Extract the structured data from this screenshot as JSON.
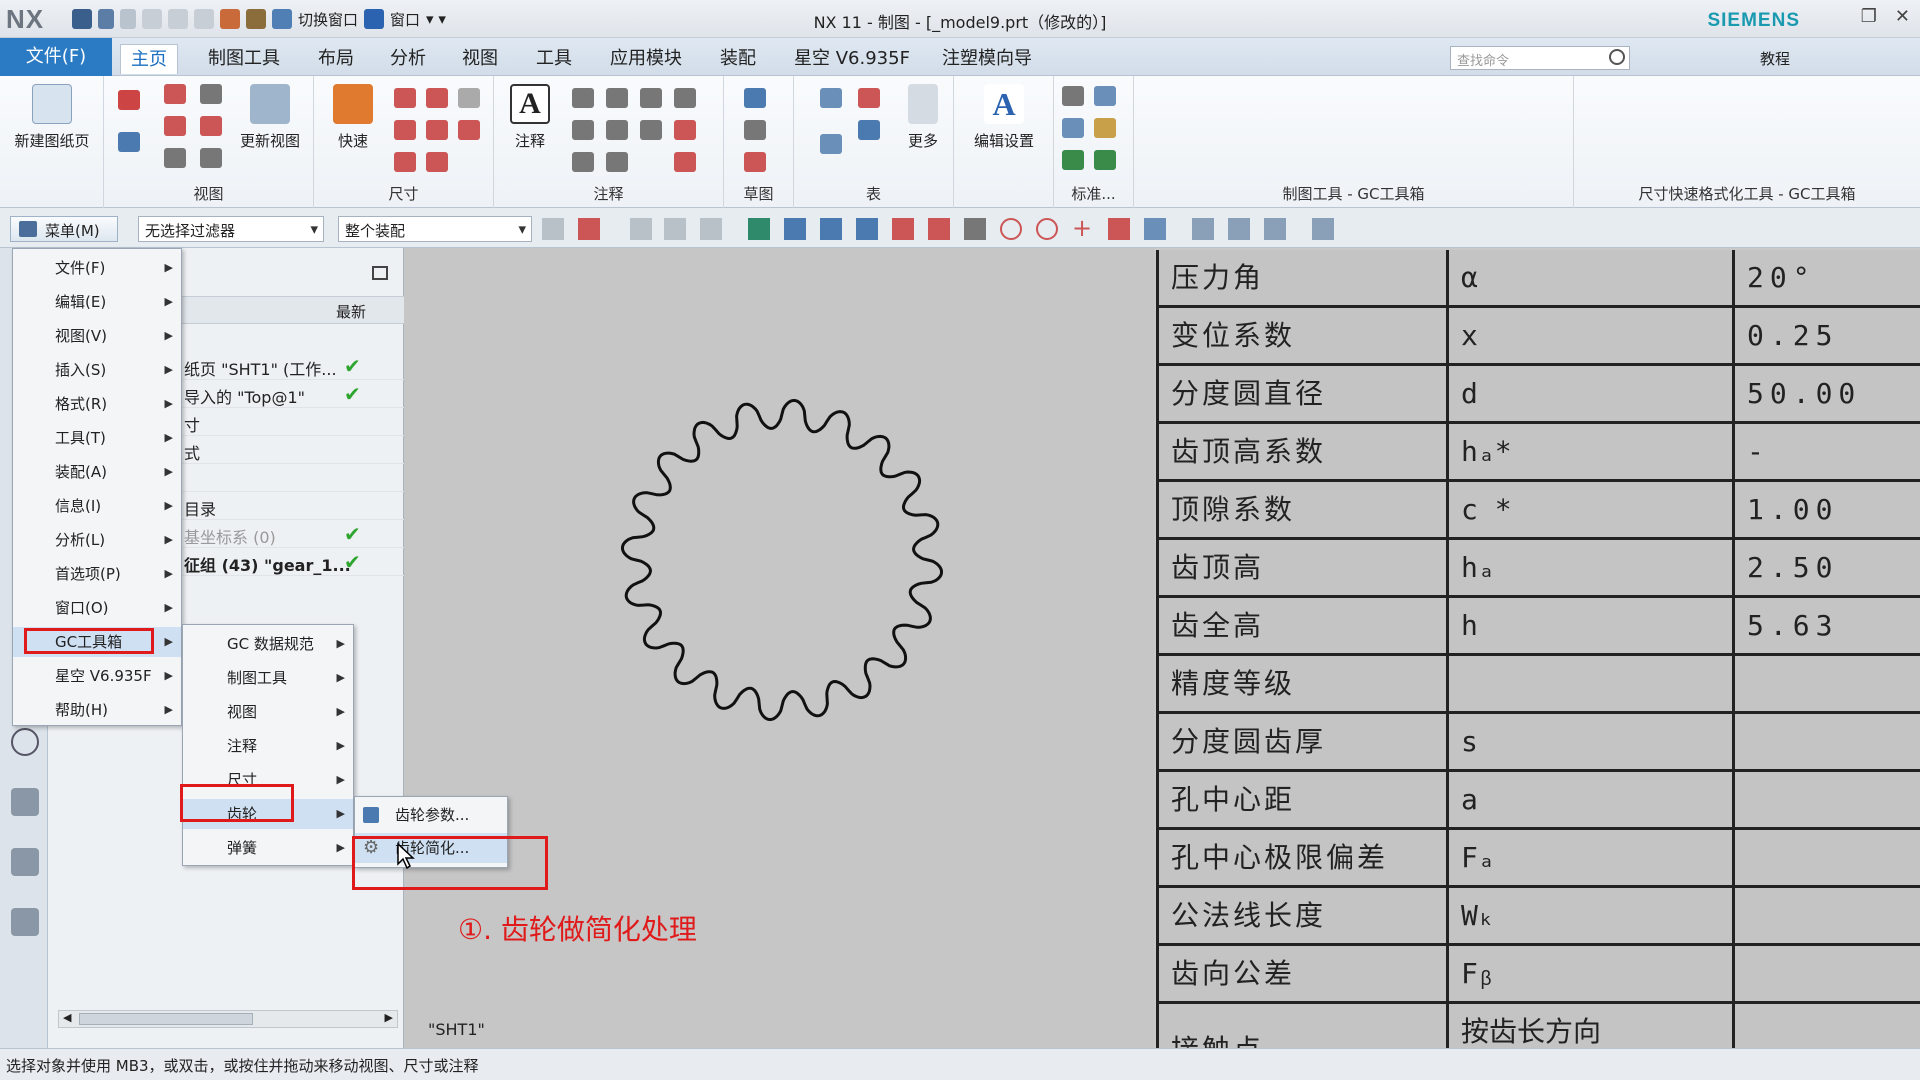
{
  "app": {
    "logo": "NX",
    "title": "NX 11 - 制图 - [_model9.prt（修改的）]",
    "brand": "SIEMENS",
    "quick_access": {
      "switch_window": "切换窗口",
      "window": "窗口"
    }
  },
  "tabs": [
    "文件(F)",
    "主页",
    "制图工具",
    "布局",
    "分析",
    "视图",
    "工具",
    "应用模块",
    "装配",
    "星空 V6.935F",
    "注塑模向导"
  ],
  "search": {
    "placeholder": "查找命令"
  },
  "tutorial_label": "教程",
  "ribbon": {
    "new_sheet": "新建图纸页",
    "group_view": "视图",
    "update_view": "更新视图",
    "quick": "快速",
    "group_dim": "尺寸",
    "annotation": "注释",
    "group_annot": "注释",
    "group_sketch": "草图",
    "group_table": "表",
    "more": "更多",
    "edit_settings": "编辑设置",
    "group_standard": "标准...",
    "group_gc": "制图工具 - GC工具箱",
    "group_dimfmt": "尺寸快速格式化工具 - GC工具箱"
  },
  "cmdbar": {
    "menu_label": "菜单(M)",
    "filter": "无选择过滤器",
    "assembly": "整个装配"
  },
  "navigator": {
    "column_latest": "最新",
    "rows": [
      {
        "text": "纸页 \"SHT1\" (工作...",
        "check": true
      },
      {
        "text": "导入的 \"Top@1\"",
        "check": true
      },
      {
        "text": "寸",
        "check": false
      },
      {
        "text": "式",
        "check": false
      },
      {
        "text": "",
        "check": false
      },
      {
        "text": "目录",
        "check": false
      },
      {
        "text": "基坐标系 (0)",
        "check": true
      },
      {
        "text": "征组 (43) \"gear_1...",
        "check": true
      }
    ]
  },
  "main_menu": {
    "items": [
      "文件(F)",
      "编辑(E)",
      "视图(V)",
      "插入(S)",
      "格式(R)",
      "工具(T)",
      "装配(A)",
      "信息(I)",
      "分析(L)",
      "首选项(P)",
      "窗口(O)",
      "GC工具箱",
      "星空 V6.935F",
      "帮助(H)"
    ]
  },
  "gc_menu": {
    "items": [
      "GC 数据规范",
      "制图工具",
      "视图",
      "注释",
      "尺寸",
      "齿轮",
      "弹簧"
    ]
  },
  "gear_menu": {
    "items": [
      "齿轮参数...",
      "齿轮简化..."
    ]
  },
  "annotation": "①. 齿轮做简化处理",
  "sheet_label": "\"SHT1\"",
  "gear_table": {
    "rows": [
      {
        "name": "压力角",
        "symbol": "α",
        "value": "20°"
      },
      {
        "name": "变位系数",
        "symbol": "x",
        "value": "0.25"
      },
      {
        "name": "分度圆直径",
        "symbol": "d",
        "value": "50.00"
      },
      {
        "name": "齿顶高系数",
        "symbol": "hₐ*",
        "value": "-"
      },
      {
        "name": "顶隙系数",
        "symbol": "c *",
        "value": "1.00"
      },
      {
        "name": "齿顶高",
        "symbol": "hₐ",
        "value": "2.50"
      },
      {
        "name": "齿全高",
        "symbol": "h",
        "value": "5.63"
      },
      {
        "name": "精度等级",
        "symbol": "",
        "value": ""
      },
      {
        "name": "分度圆齿厚",
        "symbol": "s",
        "value": ""
      },
      {
        "name": "孔中心距",
        "symbol": "a",
        "value": ""
      },
      {
        "name": "孔中心极限偏差",
        "symbol": "Fₐ",
        "value": ""
      },
      {
        "name": "公法线长度",
        "symbol": "Wₖ",
        "value": ""
      },
      {
        "name": "齿向公差",
        "symbol": "Fᵦ",
        "value": ""
      },
      {
        "name": "接触点",
        "symbol": "按齿长方向",
        "value": ""
      }
    ]
  },
  "status_bar": "选择对象并使用 MB3，或双击，或按住并拖动来移动视图、尺寸或注释",
  "colors": {
    "accent": "#2b7bc4",
    "highlight_box": "#e01a1a",
    "check": "#2fa52f"
  }
}
